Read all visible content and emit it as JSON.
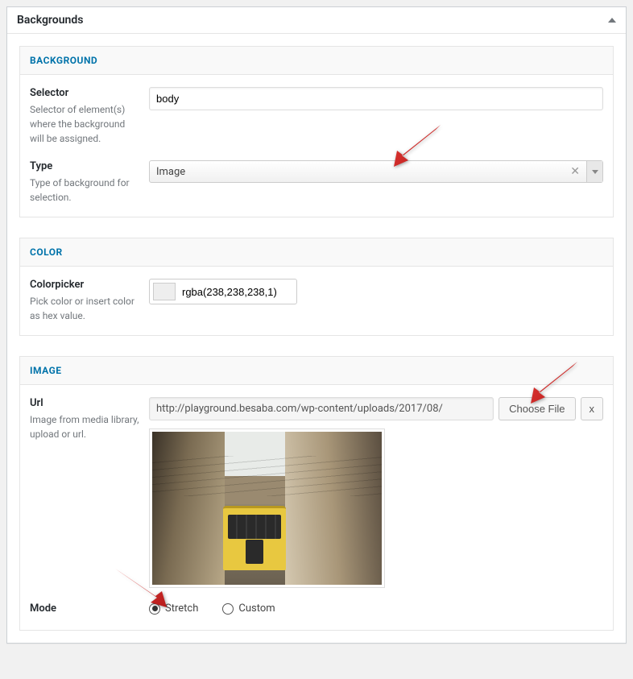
{
  "panel": {
    "title": "Backgrounds"
  },
  "background_section": {
    "header": "BACKGROUND",
    "selector": {
      "label": "Selector",
      "desc": "Selector of element(s) where the background will be assigned.",
      "value": "body"
    },
    "type": {
      "label": "Type",
      "desc": "Type of background for selection.",
      "value": "Image"
    }
  },
  "color_section": {
    "header": "COLOR",
    "colorpicker": {
      "label": "Colorpicker",
      "desc": "Pick color or insert color as hex value.",
      "value": "rgba(238,238,238,1)",
      "swatch": "#eeeeee"
    }
  },
  "image_section": {
    "header": "IMAGE",
    "url": {
      "label": "Url",
      "desc": "Image from media library, upload or url.",
      "value": "http://playground.besaba.com/wp-content/uploads/2017/08/",
      "choose_btn": "Choose File",
      "clear_btn": "x"
    },
    "mode": {
      "label": "Mode",
      "options": [
        {
          "label": "Stretch",
          "checked": true
        },
        {
          "label": "Custom",
          "checked": false
        }
      ]
    }
  }
}
